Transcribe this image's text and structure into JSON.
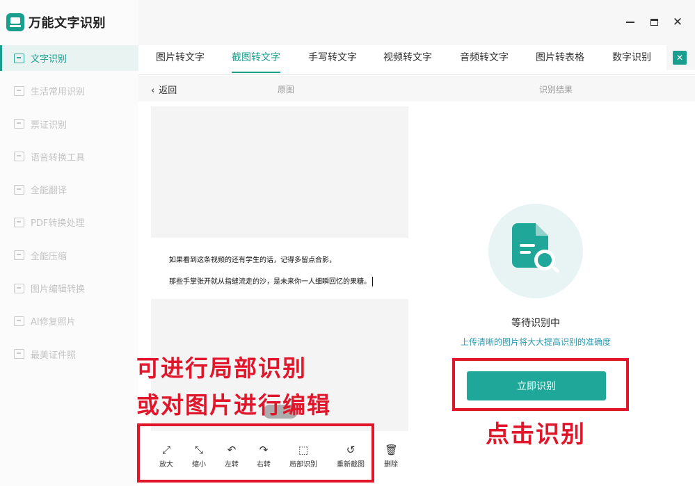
{
  "app": {
    "title": "万能文字识别",
    "icon": "app-logo-icon"
  },
  "window": {
    "minimize_icon": "minimize-icon",
    "maximize_icon": "maximize-icon",
    "close_icon": "close-icon"
  },
  "sidebar": {
    "items": [
      {
        "label": "文字识别",
        "icon": "text-recognition-icon",
        "active": true
      },
      {
        "label": "生活常用识别",
        "icon": "scan-icon",
        "active": false
      },
      {
        "label": "票证识别",
        "icon": "ticket-scan-icon",
        "active": false
      },
      {
        "label": "语音转换工具",
        "icon": "voice-icon",
        "active": false
      },
      {
        "label": "全能翻译",
        "icon": "translate-icon",
        "active": false
      },
      {
        "label": "PDF转换处理",
        "icon": "pdf-icon",
        "active": false
      },
      {
        "label": "全能压缩",
        "icon": "compress-icon",
        "active": false
      },
      {
        "label": "图片编辑转换",
        "icon": "image-edit-icon",
        "active": false
      },
      {
        "label": "AI修复照片",
        "icon": "photo-repair-icon",
        "active": false
      },
      {
        "label": "最美证件照",
        "icon": "id-photo-icon",
        "active": false
      }
    ]
  },
  "tabs": [
    {
      "label": "图片转文字",
      "active": false
    },
    {
      "label": "截图转文字",
      "active": true
    },
    {
      "label": "手写转文字",
      "active": false
    },
    {
      "label": "视频转文字",
      "active": false
    },
    {
      "label": "音频转文字",
      "active": false
    },
    {
      "label": "图片转表格",
      "active": false
    },
    {
      "label": "数字识别",
      "active": false
    }
  ],
  "subheader": {
    "back_label": "返回",
    "original_label": "原图",
    "result_label": "识别结果"
  },
  "document": {
    "lines": [
      "如果看到这条视频的还有学生的话，记得多留点合影，",
      "那些手掌张开就从指缝流走的沙，是未来你一人细瞬回忆的果糖。"
    ]
  },
  "toolbar": {
    "tools": [
      {
        "label": "放大",
        "icon": "zoom-in-icon",
        "glyph": "⤢"
      },
      {
        "label": "缩小",
        "icon": "zoom-out-icon",
        "glyph": "⤡"
      },
      {
        "label": "左转",
        "icon": "rotate-left-icon",
        "glyph": "↶"
      },
      {
        "label": "右转",
        "icon": "rotate-right-icon",
        "glyph": "↷"
      },
      {
        "label": "局部识别",
        "icon": "partial-recognition-icon",
        "glyph": "⬚"
      },
      {
        "label": "重新截图",
        "icon": "rescreenshot-icon",
        "glyph": "↺"
      },
      {
        "label": "删除",
        "icon": "delete-icon",
        "glyph": "🗑"
      }
    ]
  },
  "result_panel": {
    "status_title": "等待识别中",
    "hint": "上传清晰的图片将大大提高识别的准确度",
    "recognize_button": "立即识别"
  },
  "annotations": {
    "left_line1": "可进行局部识别",
    "left_line2": "或对图片进行编辑",
    "right": "点击识别"
  },
  "colors": {
    "accent": "#1fa89a",
    "annotation_red": "#e0162b"
  }
}
